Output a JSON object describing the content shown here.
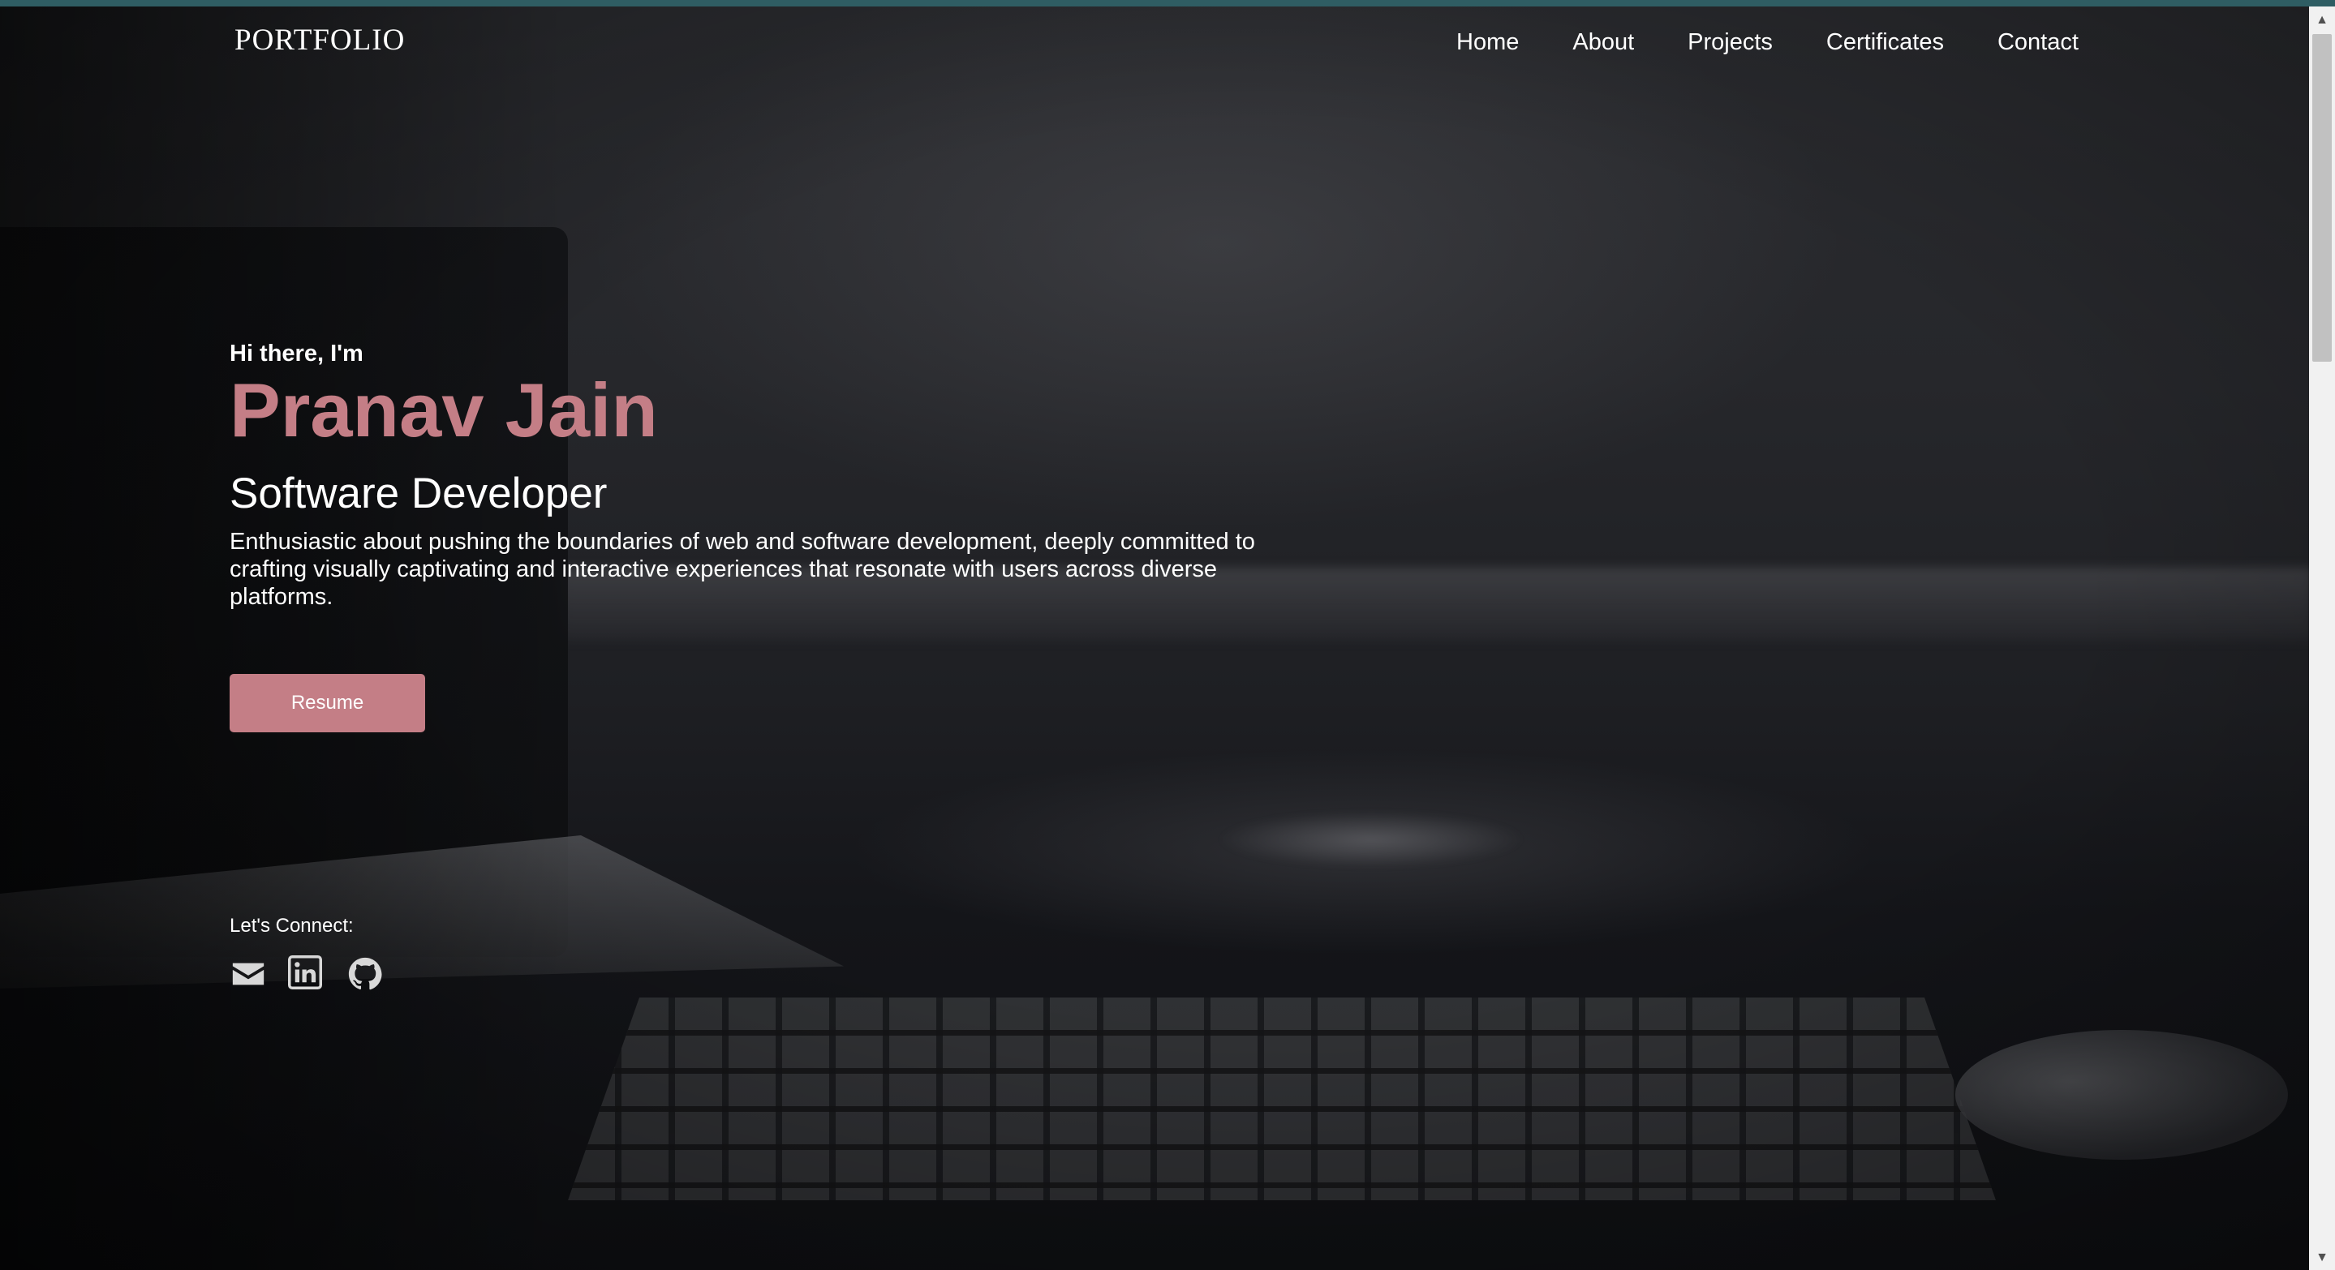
{
  "header": {
    "logo": "PORTFOLIO",
    "nav": [
      "Home",
      "About",
      "Projects",
      "Certificates",
      "Contact"
    ]
  },
  "hero": {
    "greeting": "Hi there, I'm",
    "name": "Pranav Jain",
    "role": "Software Developer",
    "description": "Enthusiastic about pushing the boundaries of web and software development, deeply committed to crafting visually captivating and interactive experiences that resonate with users across diverse platforms.",
    "resume_label": "Resume"
  },
  "connect": {
    "label": "Let's Connect:",
    "icons": [
      "email-icon",
      "linkedin-icon",
      "github-icon"
    ]
  },
  "colors": {
    "accent": "#c47e86",
    "top_border": "#2f5d63"
  }
}
